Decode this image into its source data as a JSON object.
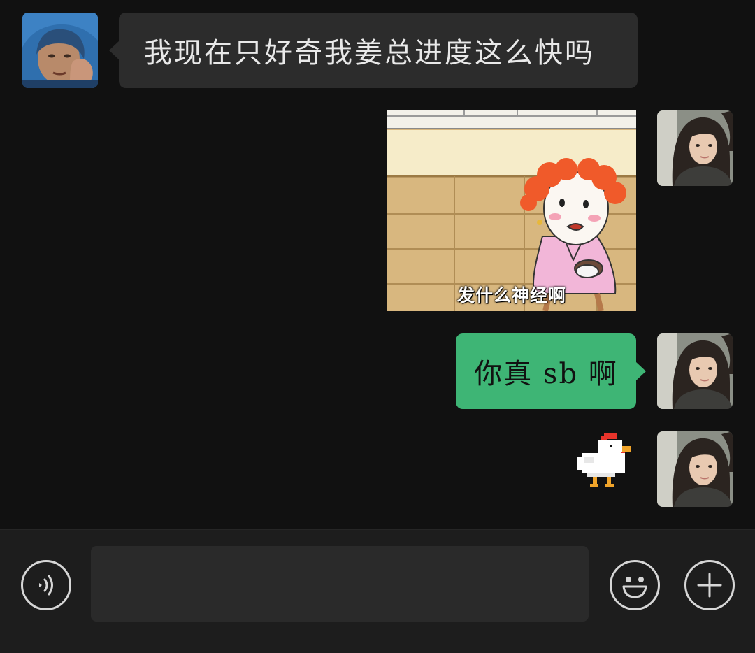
{
  "messages": [
    {
      "side": "left",
      "type": "text",
      "text": "我现在只好奇我姜总进度这么快吗"
    },
    {
      "side": "right",
      "type": "image",
      "caption": "发什么神经啊"
    },
    {
      "side": "right",
      "type": "text",
      "text": "你真 sb 啊"
    },
    {
      "side": "right",
      "type": "sticker",
      "sticker": "pixel-chicken"
    }
  ],
  "input_bar": {
    "message_value": "",
    "voice_icon": "voice-icon",
    "emoji_icon": "emoji-icon",
    "add_icon": "plus-icon"
  },
  "colors": {
    "background": "#111111",
    "incoming_bubble": "#2c2c2c",
    "outgoing_bubble": "#3eb575",
    "input_bar": "#1d1d1d"
  }
}
